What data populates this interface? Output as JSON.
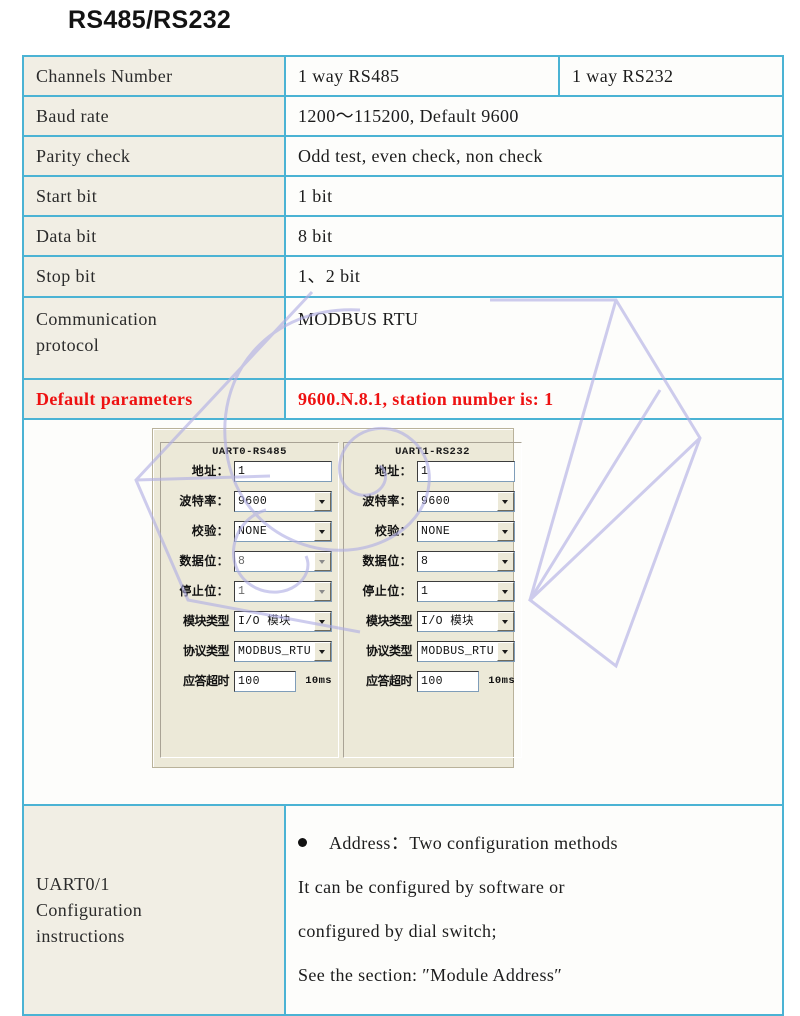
{
  "page": {
    "title": "RS485/RS232"
  },
  "colors": {
    "border": "#4bb3d4",
    "label_bg": "#f1eee4",
    "highlight_text": "#ee1111",
    "watermark": "#b0aee4",
    "dialog_bg": "#ece9d8"
  },
  "spec_table": {
    "rows": [
      {
        "label": "Channels Number",
        "value_a": "1 way RS485",
        "value_b": "1 way RS232"
      },
      {
        "label": "Baud rate",
        "value": "1200～115200, Default 9600"
      },
      {
        "label": "Parity check",
        "value": "Odd test, even check, non check"
      },
      {
        "label": "Start bit",
        "value": "1 bit"
      },
      {
        "label": "Data bit",
        "value": "8 bit"
      },
      {
        "label": "Stop bit",
        "value": "1、2 bit"
      },
      {
        "label_line1": "Communication",
        "label_line2": "protocol",
        "value": "MODBUS RTU"
      },
      {
        "label": "Default parameters",
        "value": "9600.N.8.1, station number is: 1",
        "highlight": true
      }
    ]
  },
  "config_dialog": {
    "panels": [
      {
        "title": "UART0-RS485",
        "fields": [
          {
            "label": "地址：",
            "type": "text",
            "value": "1"
          },
          {
            "label": "波特率：",
            "type": "combo",
            "value": "9600",
            "dim": false
          },
          {
            "label": "校验：",
            "type": "combo",
            "value": "NONE",
            "dim": false
          },
          {
            "label": "数据位：",
            "type": "combo",
            "value": "8",
            "dim": true
          },
          {
            "label": "停止位：",
            "type": "combo",
            "value": "1",
            "dim": true
          },
          {
            "label": "模块类型",
            "type": "combo",
            "value": "I/O 模块",
            "dim": false
          },
          {
            "label": "协议类型",
            "type": "combo",
            "value": "MODBUS_RTU",
            "dim": false
          },
          {
            "label": "应答超时",
            "type": "text-unit",
            "value": "100",
            "unit": "10ms"
          }
        ]
      },
      {
        "title": "UART1-RS232",
        "fields": [
          {
            "label": "地址：",
            "type": "text",
            "value": "1"
          },
          {
            "label": "波特率：",
            "type": "combo",
            "value": "9600",
            "dim": false
          },
          {
            "label": "校验：",
            "type": "combo",
            "value": "NONE",
            "dim": false
          },
          {
            "label": "数据位：",
            "type": "combo",
            "value": "8",
            "dim": false
          },
          {
            "label": "停止位：",
            "type": "combo",
            "value": "1",
            "dim": false
          },
          {
            "label": "模块类型",
            "type": "combo",
            "value": "I/O 模块",
            "dim": false
          },
          {
            "label": "协议类型",
            "type": "combo",
            "value": "MODBUS_RTU",
            "dim": false
          },
          {
            "label": "应答超时",
            "type": "text-unit",
            "value": "100",
            "unit": "10ms"
          }
        ]
      }
    ]
  },
  "instructions": {
    "label_line1": "UART0/1",
    "label_line2": "Configuration",
    "label_line3": "instructions",
    "lines": [
      "Address：Two configuration methods",
      "It can be configured by software or",
      "configured by dial switch;",
      "See the section: ″Module Address″"
    ]
  }
}
